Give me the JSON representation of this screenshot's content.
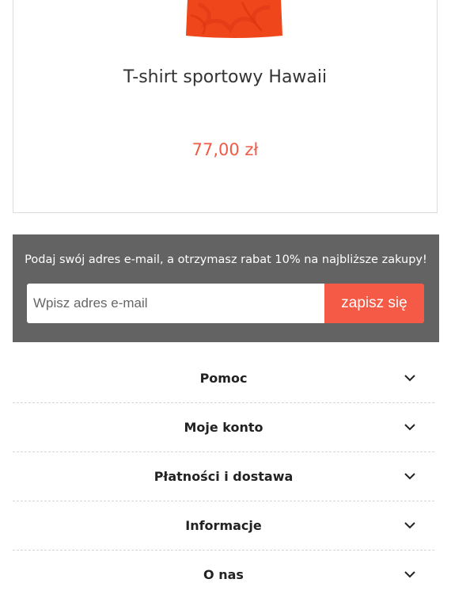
{
  "product": {
    "name": "T-shirt sportowy Hawaii",
    "price": "77,00 zł"
  },
  "newsletter": {
    "text": "Podaj swój adres e-mail, a otrzymasz rabat 10% na najbliższe zakupy!",
    "email_placeholder": "Wpisz adres e-mail",
    "subscribe_label": "zapisz się"
  },
  "footer": {
    "sections": [
      {
        "label": "Pomoc"
      },
      {
        "label": "Moje konto"
      },
      {
        "label": "Płatności i dostawa"
      },
      {
        "label": "Informacje"
      },
      {
        "label": "O nas"
      }
    ]
  },
  "colors": {
    "accent": "#f45a45",
    "price": "#f05a46",
    "newsletter_bg": "#636363"
  },
  "icons": {
    "accordion": "chevron-down-icon"
  }
}
